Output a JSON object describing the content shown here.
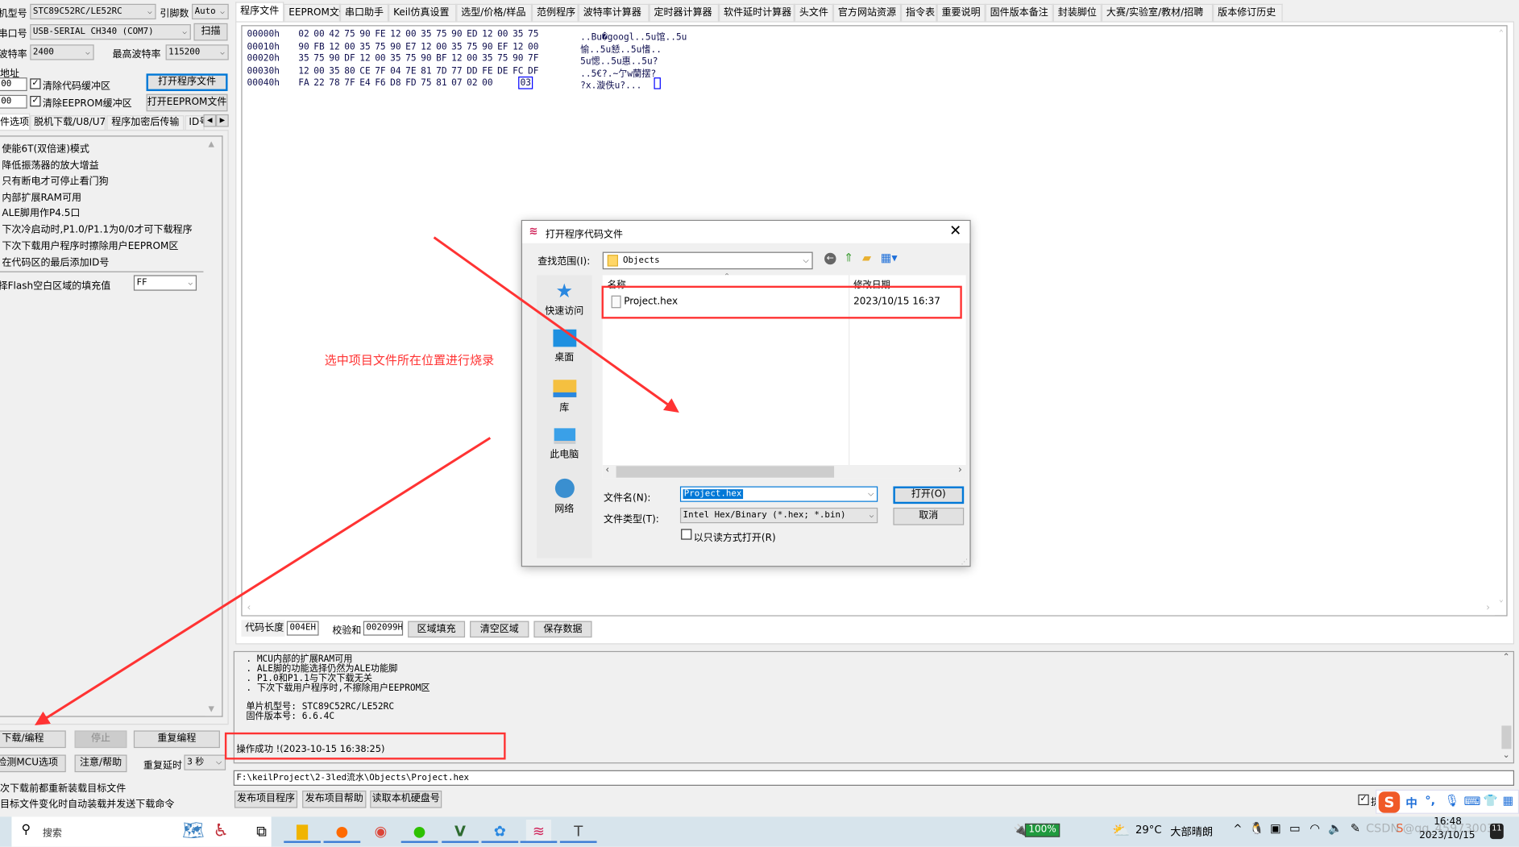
{
  "left_panel": {
    "mcu_label": "机型号",
    "mcu_value": "STC89C52RC/LE52RC",
    "pins_label": "引脚数",
    "pins_value": "Auto",
    "port_label": "串口号",
    "port_value": "USB-SERIAL CH340 (COM7)",
    "scan_button": "扫描",
    "baud_label": "波特率",
    "baud_value": "2400",
    "max_baud_label": "最高波特率",
    "max_baud_value": "115200",
    "address_label": "地址",
    "addr1": "00",
    "addr2": "00",
    "clear_code_label": "清除代码缓冲区",
    "clear_code_checked": true,
    "clear_eeprom_label": "清除EEPROM缓冲区",
    "clear_eeprom_checked": true,
    "open_program_button": "打开程序文件",
    "open_eeprom_button": "打开EEPROM文件",
    "tabs": [
      "件选项",
      "脱机下载/U8/U7",
      "程序加密后传输",
      "ID号"
    ],
    "options": [
      "使能6T(双倍速)模式",
      "降低振荡器的放大增益",
      "只有断电才可停止看门狗",
      "内部扩展RAM可用",
      "ALE脚用作P4.5口",
      "下次冷启动时,P1.0/P1.1为0/0才可下载程序",
      "下次下载用户程序时擦除用户EEPROM区",
      "在代码区的最后添加ID号"
    ],
    "fill_label": "择Flash空白区域的填充值",
    "fill_value": "FF",
    "download_button": "下载/编程",
    "stop_button": "停止",
    "repeat_button": "重复编程",
    "detect_button": "检测MCU选项",
    "help_button": "注意/帮助",
    "repeat_delay_label": "重复延时",
    "repeat_delay_value": "3 秒",
    "reload_text": "次下载前都重新装载目标文件",
    "auto_text": "目标文件变化时自动装载并发送下载命令"
  },
  "main_tabs": [
    "程序文件",
    "EEPROM文件",
    "串口助手",
    "Keil仿真设置",
    "选型/价格/样品",
    "范例程序",
    "波特率计算器",
    "定时器计算器",
    "软件延时计算器",
    "头文件",
    "官方网站资源",
    "指令表",
    "重要说明",
    "固件版本备注",
    "封装脚位",
    "大赛/实验室/教材/招聘",
    "版本修订历史"
  ],
  "hex_view": {
    "rows": [
      {
        "offset": "00000h",
        "bytes": "02 00 42 75 90 FE 12 00 35 75 90 ED 12 00 35 75",
        "ascii": "..Bu�googl..5u馆..5u"
      },
      {
        "offset": "00010h",
        "bytes": "90 FB 12 00 35 75 90 E7 12 00 35 75 90 EF 12 00",
        "ascii": "愉..5u懖..5u愭.."
      },
      {
        "offset": "00020h",
        "bytes": "35 75 90 DF 12 00 35 75 90 BF 12 00 35 75 90 7F",
        "ascii": "5u愢..5u惠..5u?"
      },
      {
        "offset": "00030h",
        "bytes": "12 00 35 80 CE 7F 04 7E 81 7D 77 DD FE DE FC DF",
        "ascii": "..5€?.~亇w蘭摆?"
      },
      {
        "offset": "00040h",
        "bytes": "FA 22 78 7F E4 F6 D8 FD 75 81 07 02 00",
        "last_byte": "03",
        "ascii": "?x.漩佚u?..."
      }
    ]
  },
  "info_bar": {
    "code_length_label": "代码长度",
    "code_length": "004EH",
    "checksum_label": "校验和",
    "checksum": "002099H",
    "fill_area_button": "区域填充",
    "clear_area_button": "清空区域",
    "save_data_button": "保存数据"
  },
  "log": {
    "lines": [
      ". MCU内部的扩展RAM可用",
      ". ALE脚的功能选择仍然为ALE功能脚",
      ". P1.0和P1.1与下次下载无关",
      ". 下次下载用户程序时,不擦除用户EEPROM区"
    ],
    "mcu_line": "单片机型号: STC89C52RC/LE52RC",
    "fw_line": "固件版本号: 6.6.4C",
    "status": "操作成功 !(2023-10-15 16:38:25)"
  },
  "path": "F:\\keilProject\\2-3led流水\\Objects\\Project.hex",
  "bottom_buttons": [
    "发布项目程序",
    "发布项目帮助",
    "读取本机硬盘号"
  ],
  "bottom_check_label": "提",
  "annotation": {
    "text": "选中项目文件所在位置进行烧录",
    "color": "#ff3333"
  },
  "dialog": {
    "title": "打开程序代码文件",
    "look_in_label": "查找范围(I):",
    "look_in_value": "Objects",
    "places": [
      "快速访问",
      "桌面",
      "库",
      "此电脑",
      "网络"
    ],
    "columns": [
      "名称",
      "修改日期"
    ],
    "files": [
      {
        "name": "Project.hex",
        "modified": "2023/10/15 16:37"
      }
    ],
    "filename_label": "文件名(N):",
    "filename_value": "Project.hex",
    "filetype_label": "文件类型(T):",
    "filetype_value": "Intel Hex/Binary (*.hex; *.bin)",
    "readonly_label": "以只读方式打开(R)",
    "readonly_checked": false,
    "open_button": "打开(O)",
    "cancel_button": "取消"
  },
  "taskbar": {
    "search_placeholder": "搜索",
    "battery": "100%",
    "weather_temp": "29°C",
    "weather_desc": "大部晴朗",
    "time": "16:48",
    "date": "2023/10/15",
    "ime_lang": "中"
  },
  "watermark": "CSDN @qq_45973003",
  "colors": {
    "accent": "#0078d7",
    "annotation_red": "#ff3333",
    "taskbar": "#d7e4ec"
  }
}
